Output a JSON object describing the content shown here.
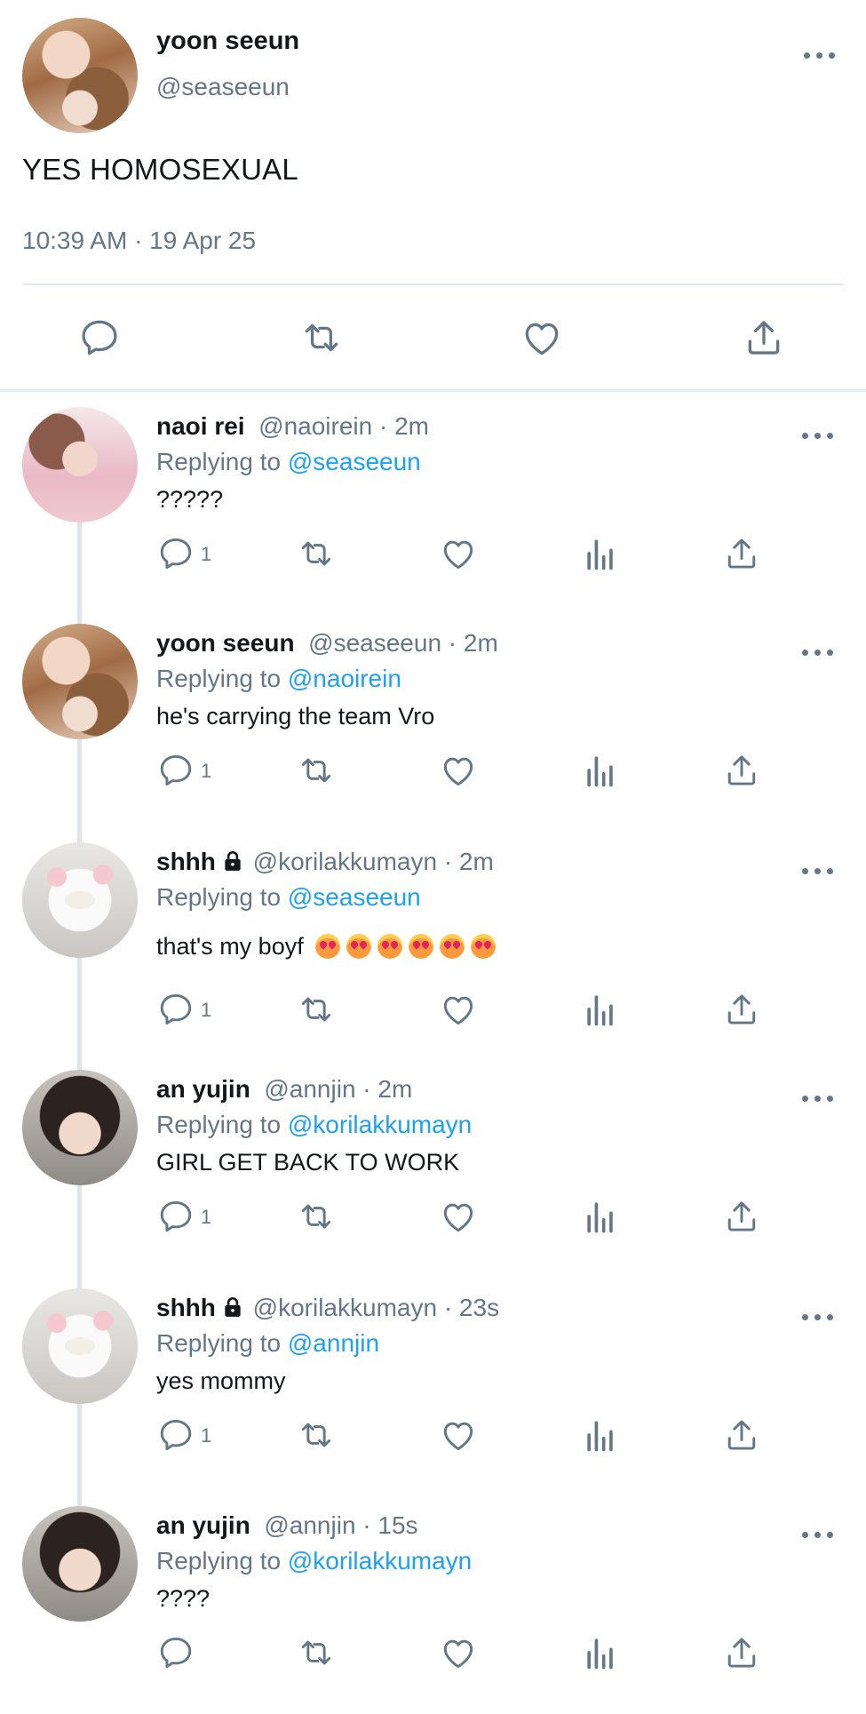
{
  "main_tweet": {
    "name": "yoon seeun",
    "handle": "@seaseeun",
    "text": "YES HOMOSEXUAL",
    "timestamp": "10:39 AM · 19 Apr 25",
    "actions": [
      "reply-icon",
      "retweet-icon",
      "like-icon",
      "share-icon"
    ]
  },
  "replies": [
    {
      "name": "naoi rei",
      "locked": false,
      "meta": "@naoirein · 2m",
      "replying_prefix": "Replying to",
      "replying_to": "@seaseeun",
      "text": "?????",
      "reply_count": "1"
    },
    {
      "name": "yoon seeun",
      "locked": false,
      "meta": "@seaseeun · 2m",
      "replying_prefix": "Replying to",
      "replying_to": "@naoirein",
      "text": "he's carrying the team Vro",
      "reply_count": "1"
    },
    {
      "name": "shhh",
      "locked": true,
      "meta": "@korilakkumayn · 2m",
      "replying_prefix": "Replying to",
      "replying_to": "@seaseeun",
      "text": "that's my boyf",
      "emojis": [
        "heart-eyes-emoji",
        "heart-eyes-emoji",
        "kissing-heart-emoji",
        "kissing-heart-emoji",
        "smiling-hearts-emoji",
        "smiling-hearts-emoji"
      ],
      "reply_count": "1"
    },
    {
      "name": "an yujin",
      "locked": false,
      "meta": "@annjin · 2m",
      "replying_prefix": "Replying to",
      "replying_to": "@korilakkumayn",
      "text": "GIRL GET BACK TO WORK",
      "reply_count": "1"
    },
    {
      "name": "shhh",
      "locked": true,
      "meta": "@korilakkumayn · 23s",
      "replying_prefix": "Replying to",
      "replying_to": "@annjin",
      "text": "yes mommy",
      "reply_count": "1"
    },
    {
      "name": "an yujin",
      "locked": false,
      "meta": "@annjin · 15s",
      "replying_prefix": "Replying to",
      "replying_to": "@korilakkumayn",
      "text": "????",
      "reply_count": ""
    }
  ],
  "icon_color": "#657786",
  "mention_color": "#1da1f2"
}
